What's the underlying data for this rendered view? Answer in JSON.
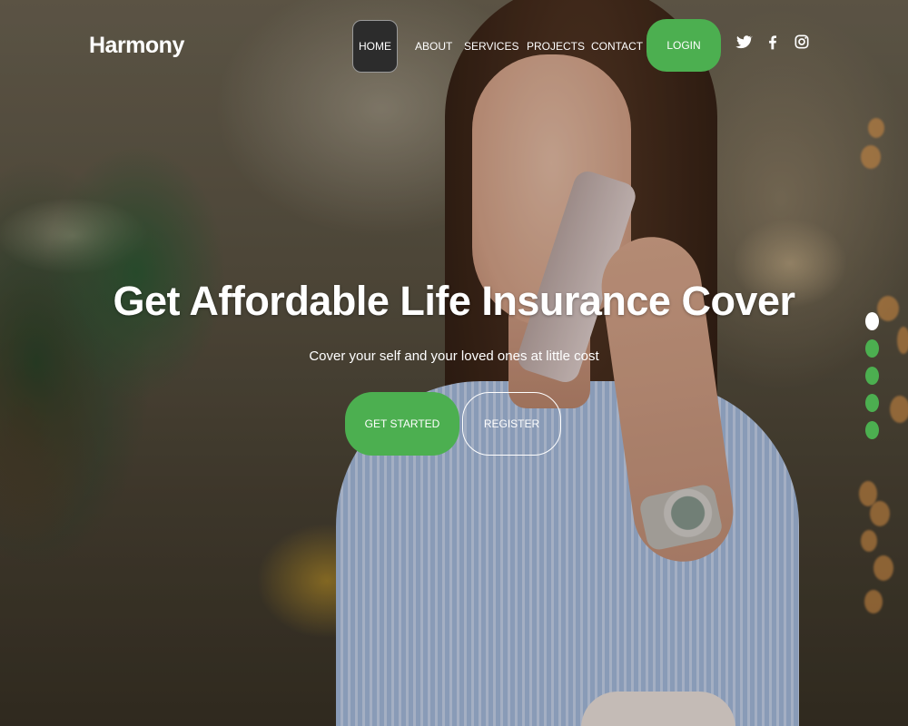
{
  "brand": {
    "name": "Harmony"
  },
  "nav": {
    "items": [
      {
        "label": "HOME",
        "active": true
      },
      {
        "label": "ABOUT",
        "active": false
      },
      {
        "label": "SERVICES",
        "active": false
      },
      {
        "label": "PROJECTS",
        "active": false
      },
      {
        "label": "CONTACT",
        "active": false
      }
    ],
    "login_label": "LOGIN"
  },
  "social": [
    "twitter-icon",
    "facebook-icon",
    "instagram-icon"
  ],
  "hero": {
    "title": "Get Affordable Life Insurance Cover",
    "subtitle": "Cover your self and your loved ones at little cost",
    "primary_cta": "GET STARTED",
    "secondary_cta": "REGISTER"
  },
  "slider": {
    "count": 5,
    "active_index": 0
  },
  "colors": {
    "accent": "#4caf50",
    "active_nav_bg": "#2c2c2c",
    "text": "#ffffff"
  }
}
